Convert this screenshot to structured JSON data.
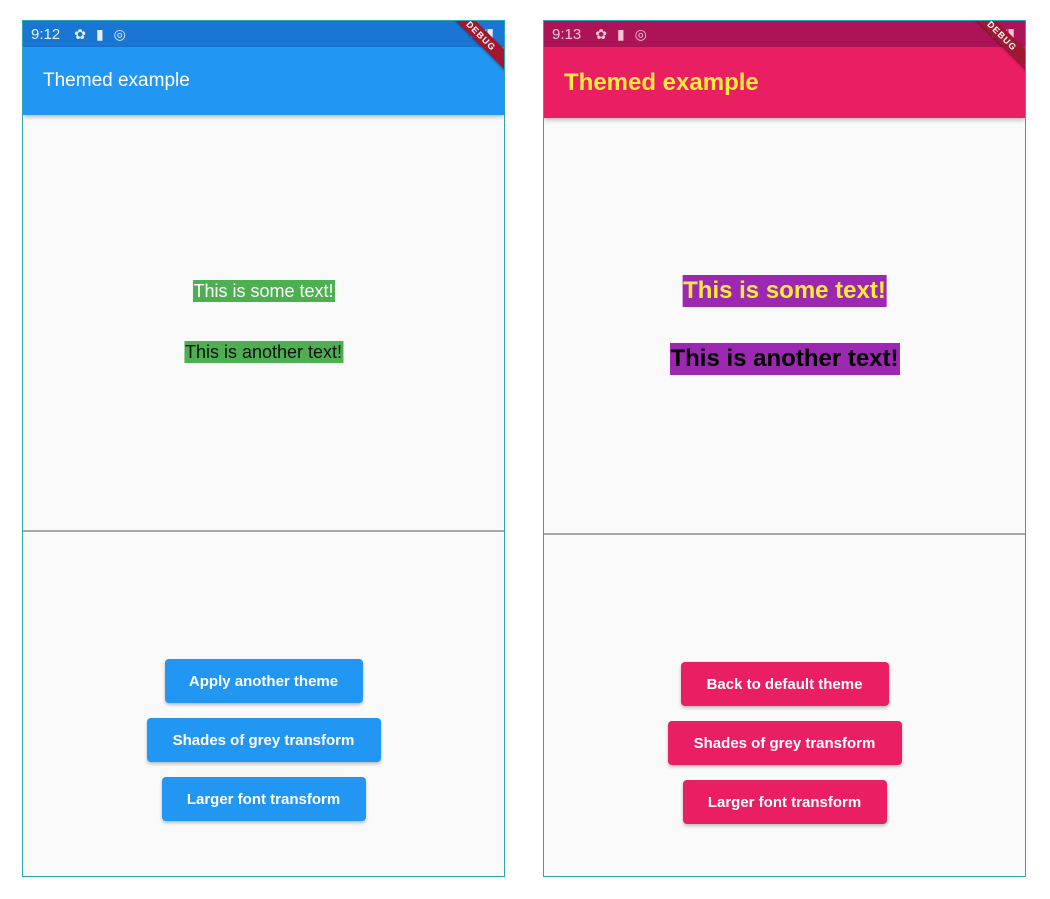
{
  "left": {
    "status": {
      "time": "9:12"
    },
    "app_bar_title": "Themed example",
    "debug_label": "DEBUG",
    "texts": {
      "first": "This is some text!",
      "second": "This is another text!"
    },
    "buttons": {
      "theme": "Apply another theme",
      "grey": "Shades of grey transform",
      "font": "Larger font transform"
    },
    "colors": {
      "primary": "#2196f3",
      "status_bar": "#1976d2",
      "text_background": "#4caf50"
    }
  },
  "right": {
    "status": {
      "time": "9:13"
    },
    "app_bar_title": "Themed example",
    "debug_label": "DEBUG",
    "texts": {
      "first": "This is some text!",
      "second": "This is another text!"
    },
    "buttons": {
      "theme": "Back to default theme",
      "grey": "Shades of grey transform",
      "font": "Larger font transform"
    },
    "colors": {
      "primary": "#e91e63",
      "status_bar": "#ad1457",
      "title_text": "#ffeb3b",
      "text_background": "#9c27b0"
    }
  },
  "icons": [
    "settings-icon",
    "sd-card-icon",
    "sync-icon",
    "wifi-icon",
    "signal-icon",
    "battery-icon"
  ]
}
